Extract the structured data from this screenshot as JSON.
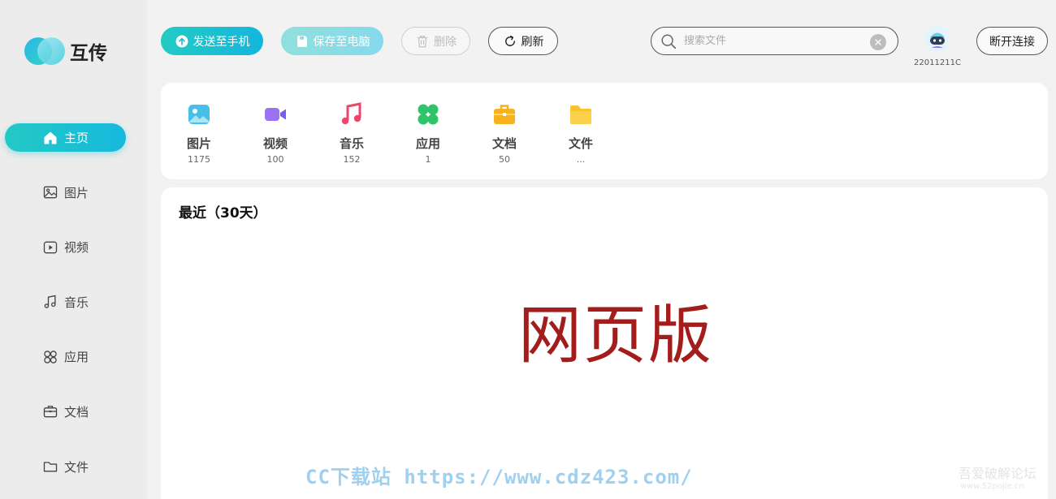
{
  "app": {
    "name": "互传"
  },
  "sidebar": {
    "items": [
      {
        "label": "主页",
        "icon": "home-icon",
        "active": true
      },
      {
        "label": "图片",
        "icon": "image-icon",
        "active": false
      },
      {
        "label": "视频",
        "icon": "video-icon",
        "active": false
      },
      {
        "label": "音乐",
        "icon": "music-icon",
        "active": false
      },
      {
        "label": "应用",
        "icon": "apps-icon",
        "active": false
      },
      {
        "label": "文档",
        "icon": "briefcase-icon",
        "active": false
      },
      {
        "label": "文件",
        "icon": "folder-icon",
        "active": false
      }
    ]
  },
  "toolbar": {
    "send_label": "发送至手机",
    "save_label": "保存至电脑",
    "delete_label": "删除",
    "refresh_label": "刷新",
    "search_placeholder": "搜索文件",
    "device_name": "22011211C",
    "disconnect_label": "断开连接"
  },
  "categories": [
    {
      "name": "图片",
      "count": "1175",
      "icon": "image-icon",
      "color": "#3fb8e6"
    },
    {
      "name": "视频",
      "count": "100",
      "icon": "video-icon",
      "color": "#8c6cf0"
    },
    {
      "name": "音乐",
      "count": "152",
      "icon": "music-icon",
      "color": "#f0456b"
    },
    {
      "name": "应用",
      "count": "1",
      "icon": "apps-icon",
      "color": "#2fc46a"
    },
    {
      "name": "文档",
      "count": "50",
      "icon": "briefcase-icon",
      "color": "#f6b21c"
    },
    {
      "name": "文件",
      "count": "...",
      "icon": "folder-icon",
      "color": "#f8c32e"
    }
  ],
  "recent": {
    "title": "最近（30天）",
    "overlay_text": "网页版"
  },
  "watermarks": {
    "site": "CC下载站 https://www.cdz423.com/",
    "forum": "吾爱破解论坛",
    "forum_url": "www.52pojie.cn"
  },
  "colors": {
    "accent": "#18bfd6",
    "overlay_text": "#a31d1d"
  }
}
